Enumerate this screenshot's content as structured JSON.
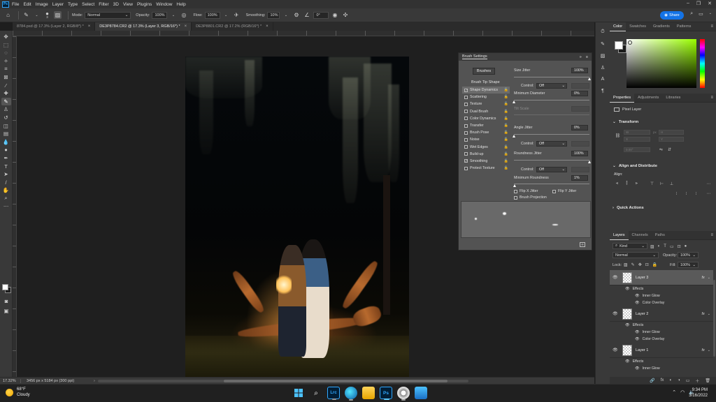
{
  "app": {
    "menu": [
      "File",
      "Edit",
      "Image",
      "Layer",
      "Type",
      "Select",
      "Filter",
      "3D",
      "View",
      "Plugins",
      "Window",
      "Help"
    ],
    "window_controls": [
      "–",
      "❐",
      "✕"
    ]
  },
  "options_bar": {
    "brush_size": "3",
    "mode_label": "Mode:",
    "mode_value": "Normal",
    "opacity_label": "Opacity:",
    "opacity_value": "100%",
    "flow_label": "Flow:",
    "flow_value": "100%",
    "smoothing_label": "Smoothing:",
    "smoothing_value": "10%",
    "angle_value": "0°",
    "share_label": "Share"
  },
  "tabs": [
    {
      "label": "8784.psd @ 17.3% (Layer 2, RGB/8*) *",
      "active": false
    },
    {
      "label": "DE3P8784.CR2 @ 17.3% (Layer 3, RGB/16*) *",
      "active": true
    },
    {
      "label": "DE3P8801.CR2 @ 17.2% (RGB/16*) *",
      "active": false
    }
  ],
  "brush_settings": {
    "title": "Brush Settings",
    "brushes_button": "Brushes",
    "tip_shape": "Brush Tip Shape",
    "items": [
      {
        "label": "Shape Dynamics",
        "checked": true,
        "selected": true
      },
      {
        "label": "Scattering",
        "checked": false,
        "selected": false
      },
      {
        "label": "Texture",
        "checked": false,
        "selected": false
      },
      {
        "label": "Dual Brush",
        "checked": false,
        "selected": false
      },
      {
        "label": "Color Dynamics",
        "checked": false,
        "selected": false
      },
      {
        "label": "Transfer",
        "checked": false,
        "selected": false
      },
      {
        "label": "Brush Pose",
        "checked": false,
        "selected": false
      },
      {
        "label": "Noise",
        "checked": false,
        "selected": false
      },
      {
        "label": "Wet Edges",
        "checked": false,
        "selected": false
      },
      {
        "label": "Build-up",
        "checked": false,
        "selected": false
      },
      {
        "label": "Smoothing",
        "checked": true,
        "selected": false
      },
      {
        "label": "Protect Texture",
        "checked": false,
        "selected": false
      }
    ],
    "size_jitter_label": "Size Jitter",
    "size_jitter_value": "100%",
    "control_label": "Control:",
    "control_value": "Off",
    "min_diameter_label": "Minimum Diameter",
    "min_diameter_value": "0%",
    "tilt_scale_label": "Tilt Scale",
    "angle_jitter_label": "Angle Jitter",
    "angle_jitter_value": "0%",
    "roundness_jitter_label": "Roundness Jitter",
    "roundness_jitter_value": "100%",
    "min_roundness_label": "Minimum Roundness",
    "min_roundness_value": "1%",
    "flip_x": "Flip X Jitter",
    "flip_y": "Flip Y Jitter",
    "brush_projection": "Brush Projection",
    "size_jitter_fraction": 1.0,
    "min_diameter_fraction": 0.0,
    "angle_jitter_fraction": 0.0,
    "roundness_jitter_fraction": 1.0,
    "min_roundness_fraction": 0.01
  },
  "color_panel": {
    "tabs": [
      "Color",
      "Swatches",
      "Gradients",
      "Patterns"
    ],
    "foreground": "#ffffff",
    "background": "#1c1c1c",
    "hue_color": "#9aff00"
  },
  "properties_panel": {
    "tabs": [
      "Properties",
      "Adjustments",
      "Libraries"
    ],
    "layer_type": "Pixel Layer",
    "transform": "Transform",
    "w_label": "W",
    "h_label": "H",
    "x_label": "X",
    "y_label": "Y",
    "unit": "px",
    "angle": "0.00°",
    "align_title": "Align and Distribute",
    "align_label": "Align:",
    "quick_actions": "Quick Actions"
  },
  "layers_panel": {
    "tabs": [
      "Layers",
      "Channels",
      "Paths"
    ],
    "kind": "Kind",
    "blend": "Normal",
    "opacity_label": "Opacity:",
    "opacity_value": "100%",
    "lock_label": "Lock:",
    "fill_label": "Fill:",
    "fill_value": "100%",
    "layers": [
      {
        "name": "Layer 3",
        "selected": true,
        "fx": "fx",
        "effects": "Effects",
        "effect_items": [
          "Inner Glow",
          "Color Overlay"
        ]
      },
      {
        "name": "Layer 2",
        "selected": false,
        "fx": "fx",
        "effects": "Effects",
        "effect_items": [
          "Inner Glow",
          "Color Overlay"
        ]
      },
      {
        "name": "Layer 1",
        "selected": false,
        "fx": "fx",
        "effects": "Effects",
        "effect_items": [
          "Inner Glow"
        ]
      }
    ],
    "footer_icons": [
      "🔗",
      "fx",
      "◐",
      "◑",
      "▭",
      "＋",
      "🗑"
    ]
  },
  "status_bar": {
    "zoom": "17.32%",
    "doc_info": "3456 px x 5184 px (300 ppi)"
  },
  "taskbar": {
    "temperature": "68°F",
    "condition": "Cloudy",
    "time": "9:34 PM",
    "date": "3/16/2022"
  }
}
